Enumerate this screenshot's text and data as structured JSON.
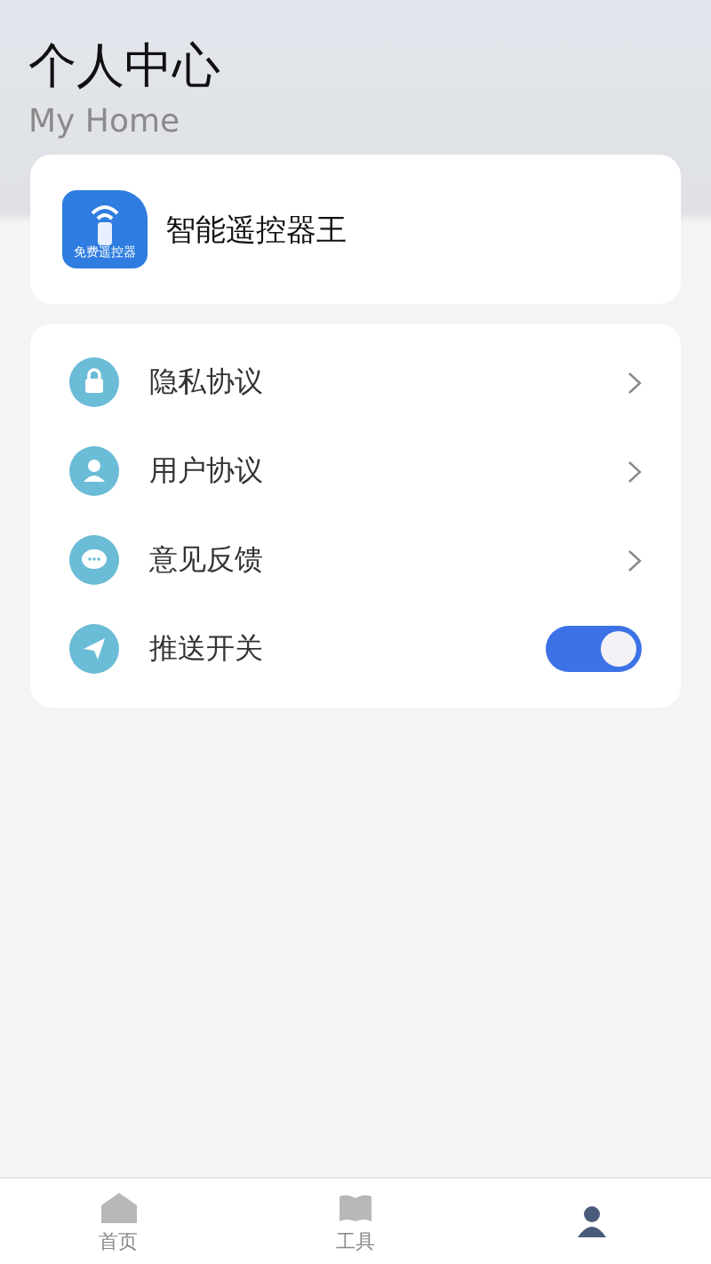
{
  "header": {
    "title": "个人中心",
    "subtitle": "My Home"
  },
  "app": {
    "name": "智能遥控器王",
    "icon_caption": "免费遥控器"
  },
  "menu": [
    {
      "kind": "link",
      "label": "隐私协议"
    },
    {
      "kind": "link",
      "label": "用户协议"
    },
    {
      "kind": "link",
      "label": "意见反馈"
    },
    {
      "kind": "toggle",
      "label": "推送开关",
      "on": true
    }
  ],
  "tabs": [
    {
      "label": "首页",
      "selected": false
    },
    {
      "label": "工具",
      "selected": false
    },
    {
      "selected": true
    }
  ]
}
